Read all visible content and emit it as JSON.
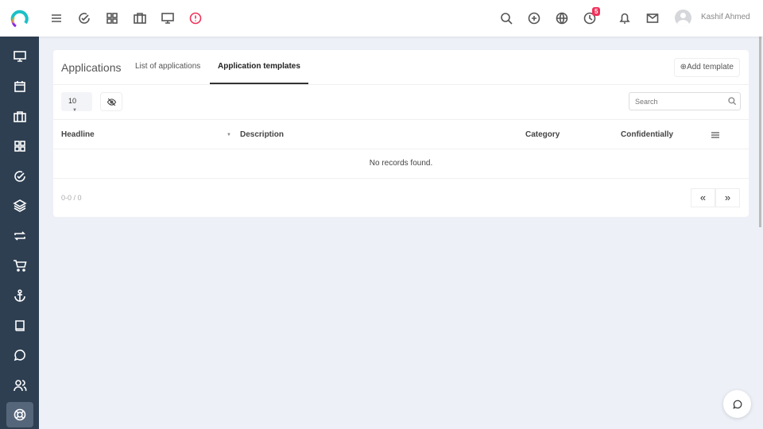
{
  "user": {
    "name": "Kashif Ahmed"
  },
  "notifications": {
    "clock_badge": "5"
  },
  "page": {
    "title": "Applications",
    "tabs": [
      {
        "label": "List of applications"
      },
      {
        "label": "Application templates"
      }
    ],
    "add_button": "Add template"
  },
  "toolbar": {
    "page_size": "10",
    "search_placeholder": "Search"
  },
  "table": {
    "columns": [
      "Headline",
      "Description",
      "Category",
      "Confidentially"
    ],
    "empty": "No records found."
  },
  "pagination": {
    "info": "0-0 / 0",
    "first": "«",
    "last": "»"
  },
  "colors": {
    "sidebar": "#2e3f52",
    "accent": "#f0325a"
  }
}
